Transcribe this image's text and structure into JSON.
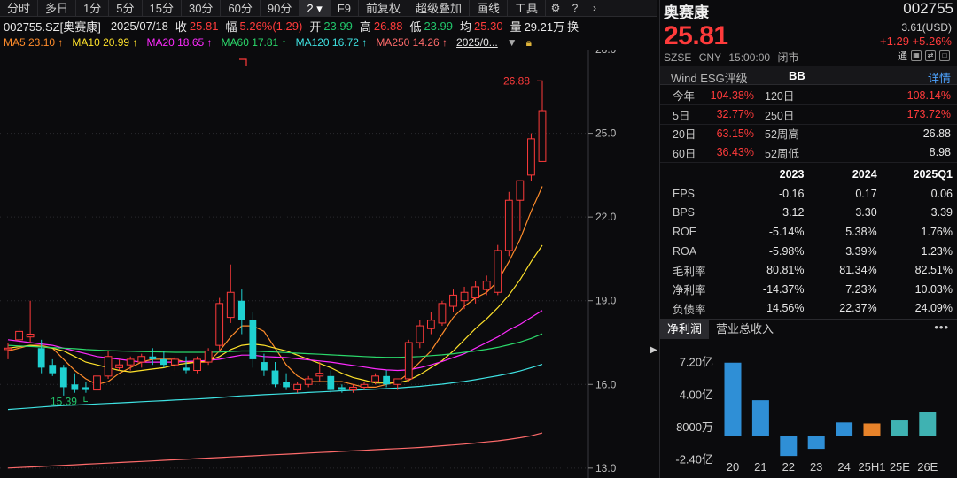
{
  "toolbar": {
    "items": [
      "分时",
      "多日",
      "1分",
      "5分",
      "15分",
      "30分",
      "60分",
      "90分",
      "2",
      "F9",
      "前复权",
      "超级叠加",
      "画线",
      "工具"
    ],
    "active_index": 8
  },
  "info": {
    "code_name": "002755.SZ[奥赛康]",
    "date": "2025/07/18",
    "close_label": "收",
    "close": "25.81",
    "change_label": "幅",
    "change": "5.26%(1.29)",
    "open_label": "开",
    "open": "23.99",
    "high_label": "高",
    "high": "26.88",
    "low_label": "低",
    "low": "23.99",
    "avg_label": "均",
    "avg": "25.30",
    "vol_label": "量",
    "vol": "29.21万",
    "turnover_label": "换"
  },
  "ma_legend": [
    {
      "label": "MA5 23.10",
      "color": "#ff8c2b"
    },
    {
      "label": "MA10 20.99",
      "color": "#ffe22b"
    },
    {
      "label": "MA20 18.65",
      "color": "#ff2bff"
    },
    {
      "label": "MA60 17.81",
      "color": "#2bd96b"
    },
    {
      "label": "MA120 16.72",
      "color": "#3fe3e3"
    },
    {
      "label": "MA250 14.26",
      "color": "#ff6b6b"
    }
  ],
  "ma_date": "2025/0...",
  "chart_data": {
    "type": "candlestick",
    "y_ticks": [
      "28.0",
      "25.0",
      "22.0",
      "19.0",
      "16.0",
      "13.0"
    ],
    "ylim": [
      12.9,
      28.0
    ],
    "annotations": {
      "high": "26.88",
      "low": "15.39"
    },
    "candles": [
      [
        17.25,
        17.5,
        16.9,
        17.3
      ],
      [
        17.6,
        18.0,
        17.4,
        17.9
      ],
      [
        17.7,
        19.0,
        17.5,
        17.8
      ],
      [
        17.3,
        17.6,
        16.4,
        16.6
      ],
      [
        16.7,
        16.9,
        16.3,
        16.4
      ],
      [
        16.6,
        16.7,
        15.6,
        15.9
      ],
      [
        16.0,
        16.4,
        15.7,
        15.8
      ],
      [
        15.9,
        16.1,
        15.7,
        15.8
      ],
      [
        15.8,
        16.4,
        15.7,
        16.3
      ],
      [
        16.3,
        17.2,
        16.2,
        17.0
      ],
      [
        16.6,
        16.9,
        16.5,
        16.7
      ],
      [
        16.7,
        17.0,
        16.5,
        16.9
      ],
      [
        16.8,
        17.1,
        16.6,
        17.0
      ],
      [
        17.0,
        17.3,
        16.7,
        16.9
      ],
      [
        16.9,
        17.2,
        16.6,
        16.7
      ],
      [
        16.7,
        17.0,
        16.5,
        16.9
      ],
      [
        16.6,
        17.0,
        16.4,
        16.5
      ],
      [
        16.5,
        17.0,
        16.4,
        16.9
      ],
      [
        16.8,
        17.3,
        16.7,
        17.2
      ],
      [
        17.4,
        19.1,
        17.2,
        18.9
      ],
      [
        18.4,
        20.3,
        18.2,
        19.3
      ],
      [
        19.0,
        19.4,
        17.8,
        18.3
      ],
      [
        18.3,
        18.6,
        16.6,
        16.9
      ],
      [
        16.8,
        17.1,
        16.3,
        16.5
      ],
      [
        16.5,
        16.8,
        15.9,
        16.0
      ],
      [
        16.1,
        16.4,
        15.8,
        15.9
      ],
      [
        15.8,
        16.1,
        15.7,
        16.0
      ],
      [
        16.0,
        16.3,
        15.9,
        16.2
      ],
      [
        16.3,
        16.8,
        16.1,
        16.4
      ],
      [
        16.3,
        16.5,
        15.7,
        15.8
      ],
      [
        15.9,
        16.0,
        15.7,
        15.8
      ],
      [
        15.8,
        16.0,
        15.7,
        15.9
      ],
      [
        15.9,
        16.1,
        15.8,
        16.0
      ],
      [
        16.1,
        16.4,
        16.0,
        16.3
      ],
      [
        16.3,
        16.5,
        15.9,
        16.0
      ],
      [
        16.0,
        16.2,
        15.8,
        16.2
      ],
      [
        16.2,
        17.6,
        16.1,
        17.5
      ],
      [
        17.5,
        18.3,
        17.3,
        18.1
      ],
      [
        18.0,
        18.6,
        17.8,
        18.3
      ],
      [
        18.2,
        19.0,
        18.1,
        18.9
      ],
      [
        18.8,
        19.4,
        18.6,
        19.2
      ],
      [
        19.0,
        19.5,
        18.7,
        19.3
      ],
      [
        19.1,
        19.7,
        18.9,
        19.5
      ],
      [
        19.4,
        19.9,
        19.2,
        19.7
      ],
      [
        19.3,
        21.0,
        19.2,
        20.8
      ],
      [
        20.8,
        22.9,
        20.6,
        22.6
      ],
      [
        22.6,
        23.2,
        21.5,
        23.3
      ],
      [
        23.5,
        25.0,
        23.3,
        24.8
      ],
      [
        23.99,
        26.88,
        23.99,
        25.81
      ]
    ],
    "ma": {
      "MA5": [
        17.2,
        17.3,
        17.4,
        17.4,
        17.3,
        16.9,
        16.5,
        16.2,
        16.0,
        16.1,
        16.4,
        16.6,
        16.8,
        16.9,
        16.9,
        16.9,
        16.8,
        16.8,
        16.8,
        17.2,
        17.7,
        18.1,
        18.1,
        17.9,
        17.3,
        16.7,
        16.3,
        16.1,
        16.1,
        16.1,
        16.1,
        16.0,
        15.9,
        15.9,
        16.0,
        16.1,
        16.4,
        16.8,
        17.2,
        17.8,
        18.4,
        18.8,
        19.1,
        19.3,
        19.7,
        20.4,
        21.2,
        22.2,
        23.1
      ],
      "MA10": [
        17.3,
        17.35,
        17.4,
        17.35,
        17.3,
        17.2,
        17.0,
        16.8,
        16.7,
        16.6,
        16.5,
        16.45,
        16.5,
        16.55,
        16.6,
        16.7,
        16.75,
        16.8,
        16.85,
        17.0,
        17.25,
        17.4,
        17.45,
        17.4,
        17.3,
        17.2,
        17.05,
        16.9,
        16.75,
        16.6,
        16.4,
        16.25,
        16.15,
        16.05,
        16.05,
        16.05,
        16.15,
        16.35,
        16.6,
        16.85,
        17.2,
        17.6,
        18.0,
        18.35,
        18.75,
        19.2,
        19.75,
        20.4,
        20.99
      ],
      "MA20": [
        17.6,
        17.55,
        17.5,
        17.45,
        17.4,
        17.3,
        17.2,
        17.1,
        17.0,
        16.95,
        16.9,
        16.85,
        16.8,
        16.8,
        16.8,
        16.8,
        16.82,
        16.84,
        16.86,
        16.9,
        16.98,
        17.05,
        17.05,
        17.0,
        16.98,
        16.96,
        16.92,
        16.88,
        16.84,
        16.8,
        16.74,
        16.68,
        16.62,
        16.56,
        16.52,
        16.5,
        16.52,
        16.6,
        16.7,
        16.82,
        16.96,
        17.1,
        17.3,
        17.5,
        17.7,
        17.95,
        18.15,
        18.4,
        18.65
      ],
      "MA60": [
        17.4,
        17.38,
        17.36,
        17.34,
        17.32,
        17.3,
        17.28,
        17.25,
        17.23,
        17.21,
        17.2,
        17.19,
        17.18,
        17.17,
        17.16,
        17.15,
        17.15,
        17.15,
        17.15,
        17.16,
        17.18,
        17.2,
        17.2,
        17.18,
        17.16,
        17.14,
        17.12,
        17.1,
        17.08,
        17.06,
        17.04,
        17.02,
        17.0,
        16.98,
        16.97,
        16.97,
        16.98,
        17.0,
        17.03,
        17.06,
        17.1,
        17.15,
        17.2,
        17.26,
        17.33,
        17.42,
        17.52,
        17.65,
        17.81
      ],
      "MA120": [
        15.1,
        15.13,
        15.16,
        15.19,
        15.22,
        15.24,
        15.26,
        15.28,
        15.3,
        15.32,
        15.34,
        15.36,
        15.38,
        15.4,
        15.42,
        15.44,
        15.46,
        15.48,
        15.5,
        15.53,
        15.56,
        15.59,
        15.61,
        15.63,
        15.65,
        15.67,
        15.69,
        15.71,
        15.73,
        15.75,
        15.77,
        15.79,
        15.81,
        15.83,
        15.85,
        15.87,
        15.9,
        15.93,
        15.97,
        16.01,
        16.06,
        16.11,
        16.17,
        16.24,
        16.31,
        16.39,
        16.48,
        16.6,
        16.72
      ],
      "MA250": [
        13.0,
        13.02,
        13.04,
        13.06,
        13.08,
        13.1,
        13.12,
        13.14,
        13.16,
        13.18,
        13.2,
        13.22,
        13.24,
        13.26,
        13.28,
        13.3,
        13.32,
        13.34,
        13.36,
        13.38,
        13.4,
        13.42,
        13.44,
        13.46,
        13.48,
        13.5,
        13.52,
        13.54,
        13.56,
        13.58,
        13.6,
        13.62,
        13.64,
        13.66,
        13.68,
        13.7,
        13.72,
        13.74,
        13.77,
        13.8,
        13.83,
        13.86,
        13.9,
        13.94,
        13.98,
        14.03,
        14.09,
        14.16,
        14.26
      ]
    },
    "colors": {
      "up": "#ff3b3b",
      "down": "#1fd1d1",
      "grid": "#2a2a2e"
    }
  },
  "panel": {
    "name": "奥赛康",
    "code": "002755",
    "price": "25.81",
    "usd": "3.61(USD)",
    "change": "+1.29  +5.26%",
    "sub": [
      "SZSE",
      "CNY",
      "15:00:00",
      "闭市"
    ],
    "tong": "通",
    "esg_label": "Wind ESG评级",
    "esg_rating": "BB",
    "esg_detail": "详情",
    "perf": [
      {
        "l1": "今年",
        "v1": "104.38%",
        "l2": "120日",
        "v2": "108.14%",
        "c2": "red"
      },
      {
        "l1": "5日",
        "v1": "32.77%",
        "l2": "250日",
        "v2": "173.72%",
        "c2": "red"
      },
      {
        "l1": "20日",
        "v1": "63.15%",
        "l2": "52周高",
        "v2": "26.88",
        "c2": "white"
      },
      {
        "l1": "60日",
        "v1": "36.43%",
        "l2": "52周低",
        "v2": "8.98",
        "c2": "white"
      }
    ],
    "fin_headers": [
      "2023",
      "2024",
      "2025Q1"
    ],
    "fin_rows": [
      {
        "label": "EPS",
        "vals": [
          "-0.16",
          "0.17",
          "0.06"
        ]
      },
      {
        "label": "BPS",
        "vals": [
          "3.12",
          "3.30",
          "3.39"
        ]
      },
      {
        "label": "ROE",
        "vals": [
          "-5.14%",
          "5.38%",
          "1.76%"
        ]
      },
      {
        "label": "ROA",
        "vals": [
          "-5.98%",
          "3.39%",
          "1.23%"
        ]
      },
      {
        "label": "毛利率",
        "vals": [
          "80.81%",
          "81.34%",
          "82.51%"
        ]
      },
      {
        "label": "净利率",
        "vals": [
          "-14.37%",
          "7.23%",
          "10.03%"
        ]
      },
      {
        "label": "负债率",
        "vals": [
          "14.56%",
          "22.37%",
          "24.09%"
        ]
      }
    ],
    "tabs": [
      "净利润",
      "营业总收入"
    ],
    "more": "•••"
  },
  "bar_chart": {
    "type": "bar",
    "categories": [
      "20",
      "21",
      "22",
      "23",
      "24",
      "25H1",
      "25E",
      "26E"
    ],
    "values": [
      7.2,
      3.5,
      -2.0,
      -1.3,
      1.3,
      1.2,
      1.5,
      2.3
    ],
    "y_ticks": [
      "7.20亿",
      "4.00亿",
      "8000万",
      "-2.40亿"
    ],
    "y_tick_values": [
      7.2,
      4.0,
      0.8,
      -2.4
    ],
    "ylim": [
      -2.6,
      8.4
    ],
    "colors": [
      "#2f8fd6",
      "#2f8fd6",
      "#2f8fd6",
      "#2f8fd6",
      "#2f8fd6",
      "#e8832a",
      "#3fb2b2",
      "#3fb2b2"
    ]
  }
}
